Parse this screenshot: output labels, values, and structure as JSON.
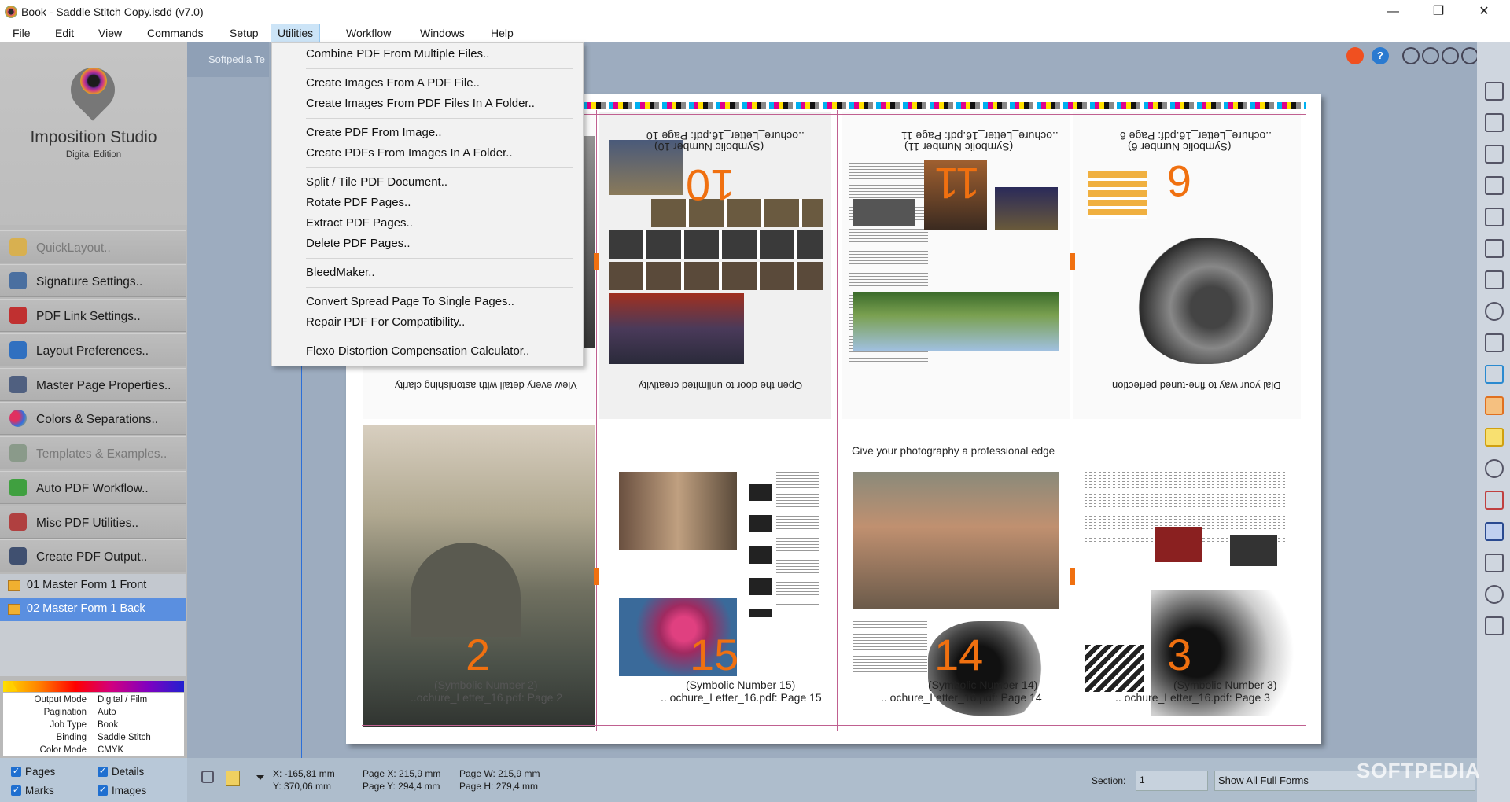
{
  "window": {
    "title": "Book - Saddle Stitch Copy.isdd (v7.0)",
    "minimize": "—",
    "restore": "❐",
    "close": "✕"
  },
  "menubar": {
    "items": [
      "File",
      "Edit",
      "View",
      "Commands",
      "Setup",
      "Utilities",
      "Workflow",
      "Windows",
      "Help"
    ]
  },
  "utilities_menu": {
    "items": [
      "Combine PDF From Multiple Files..",
      "Create Images From A PDF File..",
      "Create Images From PDF Files In A Folder..",
      "Create PDF From Image..",
      "Create PDFs From Images In A Folder..",
      "Split / Tile  PDF Document..",
      "Rotate PDF Pages..",
      "Extract PDF Pages..",
      "Delete PDF Pages..",
      "BleedMaker..",
      "Convert Spread Page To Single Pages..",
      "Repair PDF For Compatibility..",
      "Flexo Distortion Compensation Calculator.."
    ]
  },
  "sidebar": {
    "app_name": "Imposition Studio",
    "edition": "Digital Edition",
    "buttons": [
      {
        "label": "QuickLayout..",
        "icon": "lightning-icon",
        "color": "#e0a020"
      },
      {
        "label": "Signature Settings..",
        "icon": "signature-icon",
        "color": "#4a6fa0"
      },
      {
        "label": "PDF Link Settings..",
        "icon": "pdf-link-icon",
        "color": "#c03030"
      },
      {
        "label": "Layout Preferences..",
        "icon": "layout-icon",
        "color": "#3070c0"
      },
      {
        "label": "Master Page Properties..",
        "icon": "master-page-icon",
        "color": "#506080"
      },
      {
        "label": "Colors & Separations..",
        "icon": "colors-icon",
        "color": "#9050c0"
      },
      {
        "label": "Templates & Examples..",
        "icon": "templates-icon",
        "color": "#607060"
      },
      {
        "label": "Auto PDF Workflow..",
        "icon": "robot-icon",
        "color": "#40a040"
      },
      {
        "label": "Misc PDF Utilities..",
        "icon": "utilities-icon",
        "color": "#b04040"
      },
      {
        "label": "Create PDF Output..",
        "icon": "printer-icon",
        "color": "#405070"
      }
    ],
    "forms": [
      "01 Master Form 1 Front",
      "02 Master Form 1 Back"
    ],
    "info": [
      {
        "key": "Output Mode",
        "value": "Digital / Film"
      },
      {
        "key": "Pagination",
        "value": "Auto"
      },
      {
        "key": "Job Type",
        "value": "Book"
      },
      {
        "key": "Binding",
        "value": "Saddle Stitch"
      },
      {
        "key": "Color Mode",
        "value": "CMYK"
      }
    ],
    "checks": [
      "Pages",
      "Details",
      "Marks",
      "Images"
    ]
  },
  "workspace": {
    "toolbar_label": "Softpedia Te",
    "pages": [
      {
        "num": "10",
        "caption1": "(Symbolic Number 10)",
        "caption2": "..ochure_Letter_16.pdf: Page 10",
        "headline": "Open the door to unlimited creativity"
      },
      {
        "num": "11",
        "caption1": "(Symbolic Number 11)",
        "caption2": "..ochure_Letter_16.pdf: Page 11"
      },
      {
        "num": "6",
        "caption1": "(Symbolic Number 6)",
        "caption2": "..ochure_Letter_16.pdf: Page 6",
        "headline": "Dial your way to fine-tuned perfection"
      },
      {
        "num": "2",
        "caption1": "(Symbolic Number 2)",
        "caption2": "..ochure_Letter_16.pdf: Page 2"
      },
      {
        "num": "15",
        "caption1": "(Symbolic Number 15)",
        "caption2": ".. ochure_Letter_16.pdf: Page 15"
      },
      {
        "num": "14",
        "caption1": "(Symbolic Number 14)",
        "caption2": ".. ochure_Letter_16.pdf: Page 14",
        "headline": "Give your photography a professional edge"
      },
      {
        "num": "3",
        "caption1": "(Symbolic Number 3)",
        "caption2": ".. ochure_Letter_16.pdf: Page 3"
      }
    ],
    "top_left_headline": "View every detail with astonishing clarity"
  },
  "statusbar": {
    "x": "X: -165,81 mm",
    "y": "Y: 370,06 mm",
    "page_x": "Page X: 215,9 mm",
    "page_y": "Page Y: 294,4 mm",
    "page_w": "Page W: 215,9 mm",
    "page_h": "Page H: 279,4 mm",
    "section_label": "Section:",
    "section_value": "1",
    "forms_value": "Show All Full Forms",
    "watermark": "SOFTPEDIA"
  },
  "colors": {
    "accent": "#f07010",
    "selected_form": "#5a8fe0",
    "guide": "#2c6fd8"
  }
}
